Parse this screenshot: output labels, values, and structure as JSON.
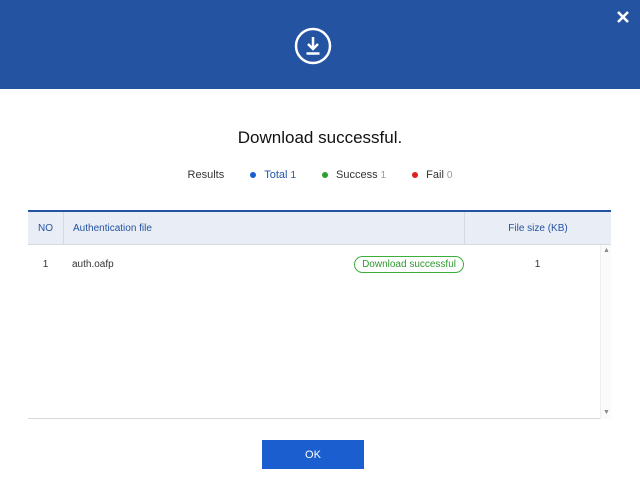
{
  "header": {
    "icon": "download-icon",
    "close_icon": "close-icon",
    "background_color": "#2453a2"
  },
  "title": "Download successful.",
  "results": {
    "label": "Results",
    "total": {
      "name": "Total",
      "count": "1",
      "color": "#1a5ecf"
    },
    "success": {
      "name": "Success",
      "count": "1",
      "color": "#2ca02c"
    },
    "fail": {
      "name": "Fail",
      "count": "0",
      "color": "#e02020"
    }
  },
  "table": {
    "columns": {
      "no": "NO",
      "file": "Authentication file",
      "size": "File size (KB)"
    },
    "rows": [
      {
        "no": "1",
        "file": "auth.oafp",
        "status": "Download successful",
        "size": "1"
      }
    ]
  },
  "ok_button": {
    "label": "OK"
  },
  "accent_color": "#1a5ecf"
}
